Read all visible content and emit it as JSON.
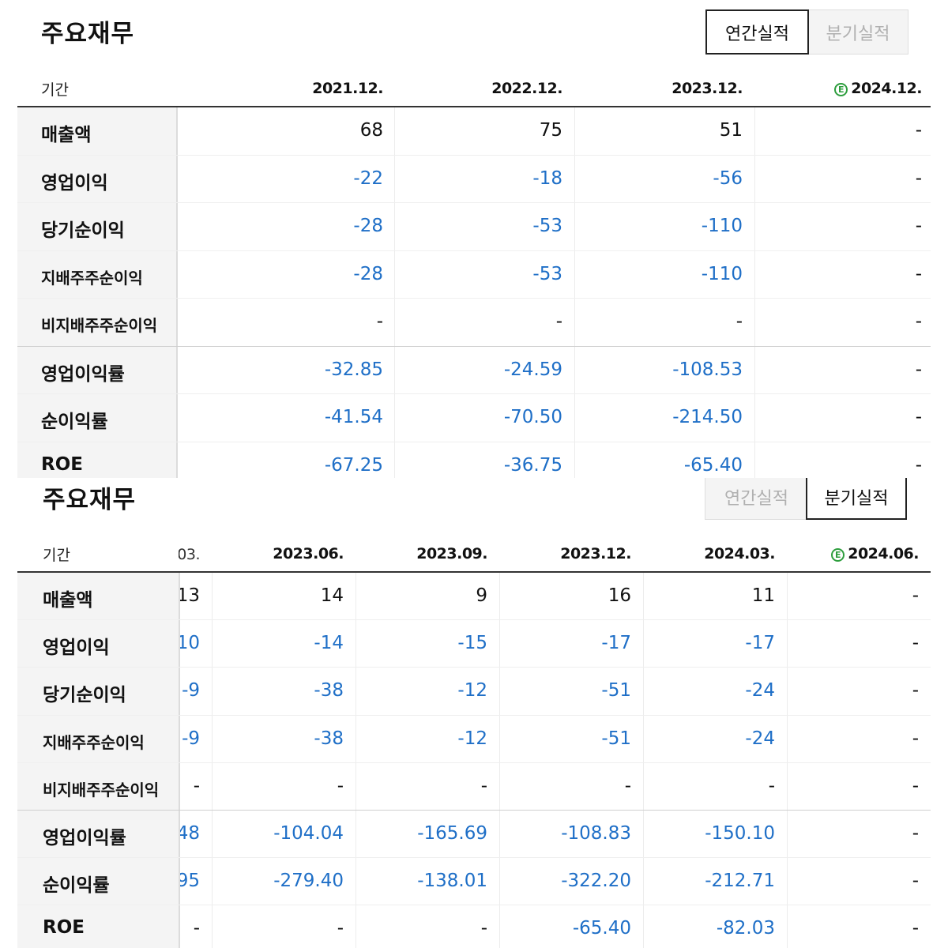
{
  "annual": {
    "title": "주요재무",
    "tabs": {
      "annual": "연간실적",
      "quarterly": "분기실적"
    },
    "header_label": "기간",
    "estimate_icon": "estimate-icon",
    "periods": [
      "2021.12.",
      "2022.12.",
      "2023.12.",
      "2024.12."
    ],
    "rows": [
      {
        "label": "매출액",
        "values": [
          "68",
          "75",
          "51",
          "-"
        ]
      },
      {
        "label": "영업이익",
        "values": [
          "-22",
          "-18",
          "-56",
          "-"
        ]
      },
      {
        "label": "당기순이익",
        "values": [
          "-28",
          "-53",
          "-110",
          "-"
        ]
      },
      {
        "label": "지배주주순이익",
        "values": [
          "-28",
          "-53",
          "-110",
          "-"
        ]
      },
      {
        "label": "비지배주주순이익",
        "values": [
          "-",
          "-",
          "-",
          "-"
        ]
      },
      {
        "label": "영업이익률",
        "values": [
          "-32.85",
          "-24.59",
          "-108.53",
          "-"
        ]
      },
      {
        "label": "순이익률",
        "values": [
          "-41.54",
          "-70.50",
          "-214.50",
          "-"
        ]
      },
      {
        "label": "ROE",
        "values": [
          "-67.25",
          "-36.75",
          "-65.40",
          "-"
        ]
      }
    ]
  },
  "quarterly": {
    "title": "주요재무",
    "tabs": {
      "annual": "연간실적",
      "quarterly": "분기실적"
    },
    "header_label": "기간",
    "estimate_icon": "estimate-icon",
    "partial_period": "03.",
    "periods": [
      "2023.06.",
      "2023.09.",
      "2023.12.",
      "2024.03.",
      "2024.06."
    ],
    "rows": [
      {
        "label": "매출액",
        "partial": "13",
        "values": [
          "14",
          "9",
          "16",
          "11",
          "-"
        ]
      },
      {
        "label": "영업이익",
        "partial": "10",
        "values": [
          "-14",
          "-15",
          "-17",
          "-17",
          "-"
        ]
      },
      {
        "label": "당기순이익",
        "partial": "-9",
        "values": [
          "-38",
          "-12",
          "-51",
          "-24",
          "-"
        ]
      },
      {
        "label": "지배주주순이익",
        "partial": "-9",
        "values": [
          "-38",
          "-12",
          "-51",
          "-24",
          "-"
        ]
      },
      {
        "label": "비지배주주순이익",
        "partial": "-",
        "values": [
          "-",
          "-",
          "-",
          "-",
          "-"
        ]
      },
      {
        "label": "영업이익률",
        "partial": "48",
        "values": [
          "-104.04",
          "-165.69",
          "-108.83",
          "-150.10",
          "-"
        ]
      },
      {
        "label": "순이익률",
        "partial": "95",
        "values": [
          "-279.40",
          "-138.01",
          "-322.20",
          "-212.71",
          "-"
        ]
      },
      {
        "label": "ROE",
        "partial": "-",
        "values": [
          "-",
          "-",
          "-65.40",
          "-82.03",
          "-"
        ]
      }
    ]
  },
  "colors": {
    "negative": "#1f6fc7",
    "estimate": "#2e9e3e",
    "label_bg": "#f4f4f4"
  }
}
